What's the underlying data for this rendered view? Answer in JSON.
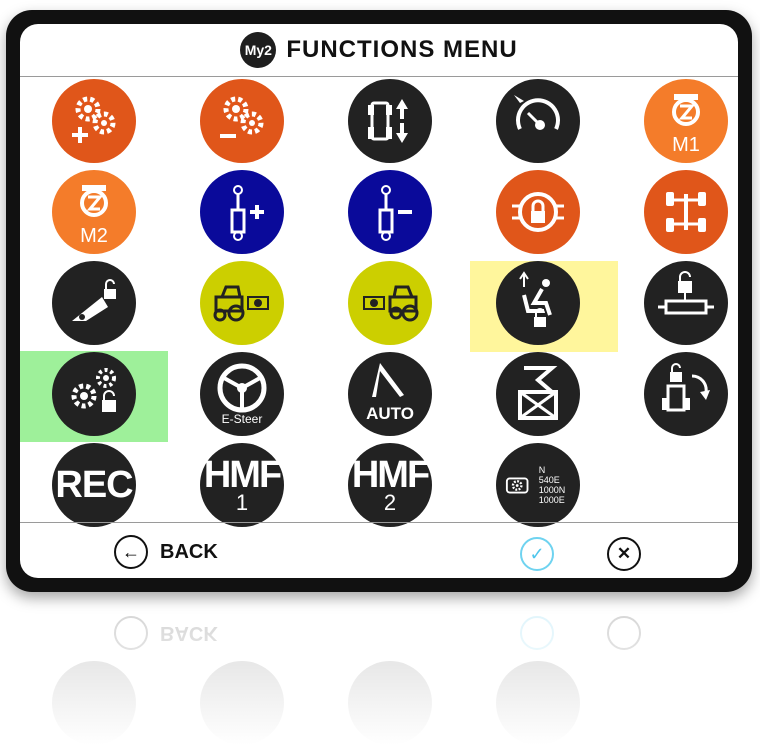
{
  "header": {
    "logo_text": "My2",
    "title": "FUNCTIONS MENU"
  },
  "labels": {
    "m1": "M1",
    "m2": "M2",
    "e_steer": "E-Steer",
    "auto": "AUTO",
    "rec": "REC",
    "hmf": "HMF",
    "hmf1": "1",
    "hmf2": "2",
    "pto_n": "N",
    "pto_540e": "540E",
    "pto_1000n": "1000N",
    "pto_1000e": "1000E"
  },
  "footer": {
    "back_label": "BACK"
  },
  "colors": {
    "orange": "#e0561a",
    "light_orange": "#f47c2a",
    "blue": "#0a0a9a",
    "black": "#222222",
    "yellow": "#cccf00",
    "highlight_yellow": "#fff69c",
    "highlight_green": "#9ef09a",
    "confirm_accent": "#4fc6ec"
  },
  "icons": [
    "gears-plus-icon",
    "gears-minus-icon",
    "tractor-lift-icon",
    "speedometer-icon",
    "engine-memory-m1-icon",
    "engine-memory-m2-icon",
    "hydraulic-plus-icon",
    "hydraulic-minus-icon",
    "cab-lock-icon",
    "four-wheel-drive-icon",
    "hitch-lock-icon",
    "front-pto-icon",
    "rear-pto-icon",
    "seat-lock-icon",
    "cylinder-lock-icon",
    "gearbox-lock-icon",
    "e-steer-icon",
    "auto-steer-icon",
    "transmission-icon",
    "linkage-rotate-icon",
    "rec-icon",
    "hmf1-icon",
    "hmf2-icon",
    "pto-speed-icon"
  ]
}
